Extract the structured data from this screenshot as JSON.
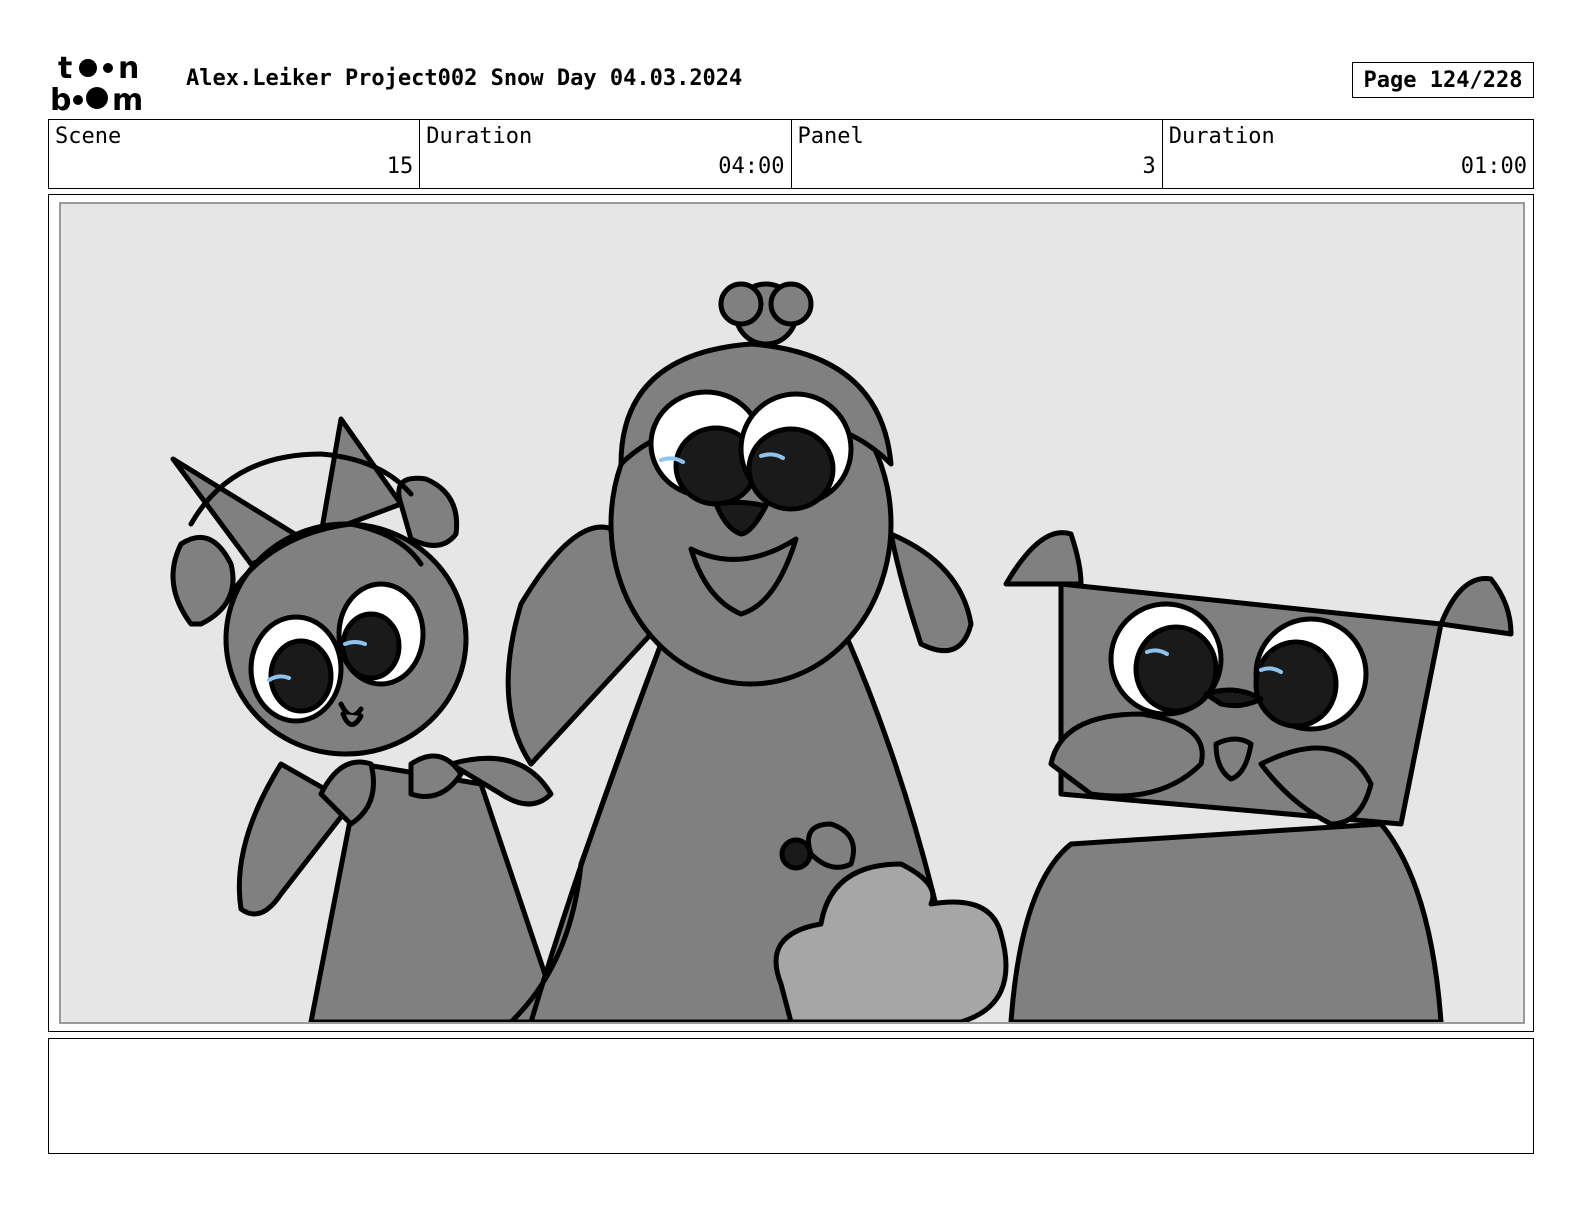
{
  "header": {
    "logo_text": "toon boom",
    "title": "Alex.Leiker Project002 Snow Day 04.03.2024",
    "page_label": "Page 124/228"
  },
  "info": {
    "scene_label": "Scene",
    "scene_value": "15",
    "scene_duration_label": "Duration",
    "scene_duration_value": "04:00",
    "panel_label": "Panel",
    "panel_value": "3",
    "panel_duration_label": "Duration",
    "panel_duration_value": "01:00"
  },
  "notes": {
    "text": ""
  },
  "colors": {
    "panel_bg": "#e6e6e6",
    "character_fill": "#808080",
    "dark_fill": "#1a1a1a",
    "highlight": "#8ec3ee"
  }
}
